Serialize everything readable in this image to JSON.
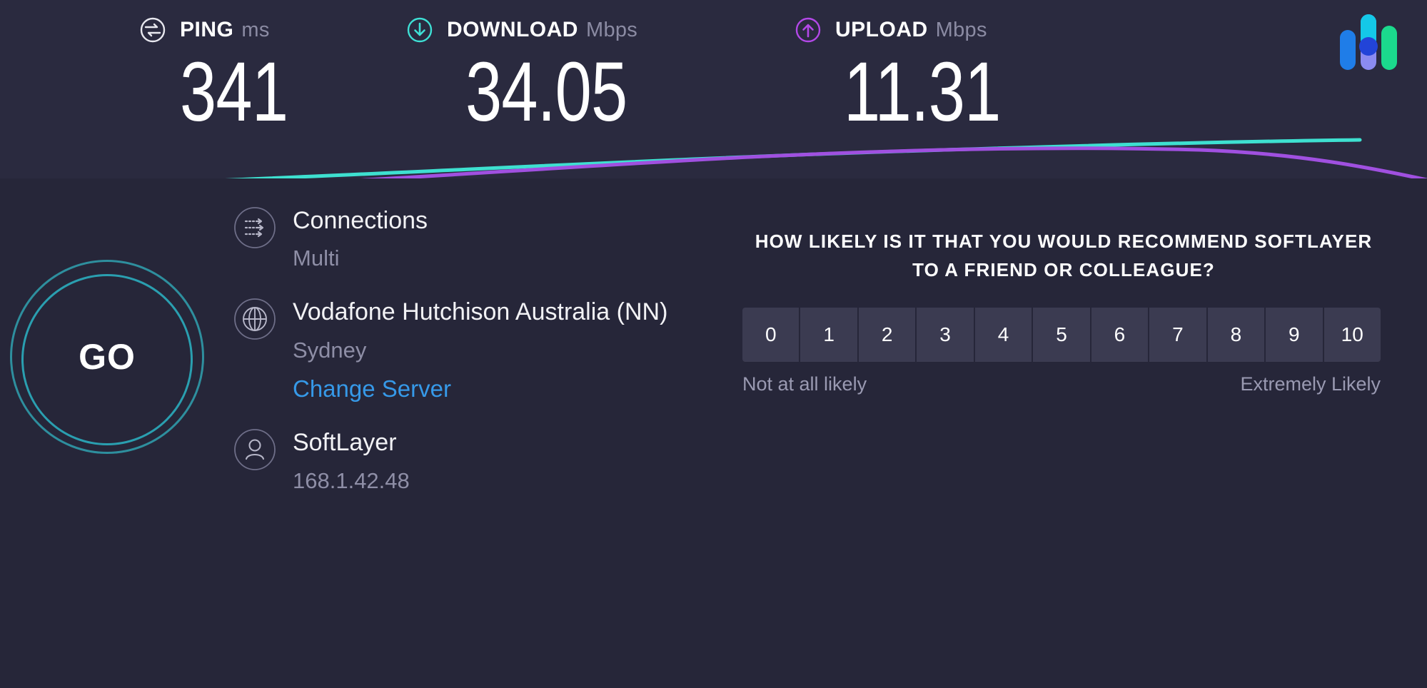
{
  "brand": {
    "logo_name": "speedtest-logo",
    "logo_colors": [
      "#1f7de8",
      "#14c8e8",
      "#8b8bf0",
      "#1bd98d"
    ]
  },
  "results": {
    "ping": {
      "label": "PING",
      "unit": "ms",
      "value": "341",
      "icon": "ping-icon",
      "icon_color": "#e8e8ef"
    },
    "download": {
      "label": "DOWNLOAD",
      "unit": "Mbps",
      "value": "34.05",
      "icon": "download-arrow-icon",
      "icon_color": "#3ee0d5"
    },
    "upload": {
      "label": "UPLOAD",
      "unit": "Mbps",
      "value": "11.31",
      "icon": "upload-arrow-icon",
      "icon_color": "#b348e8"
    }
  },
  "graph": {
    "download_line_color": "#3ee0d0",
    "upload_line_color": "#a050e0"
  },
  "go_button": {
    "label": "GO",
    "ring_color": "#2a9fb0"
  },
  "connection": {
    "connections": {
      "icon": "connections-icon",
      "title": "Connections",
      "value": "Multi"
    },
    "isp": {
      "icon": "globe-icon",
      "title": "Vodafone Hutchison Australia (NN)",
      "value": "Sydney",
      "link": "Change Server",
      "link_color": "#3699e8"
    },
    "host": {
      "icon": "person-icon",
      "title": "SoftLayer",
      "value": "168.1.42.48"
    }
  },
  "survey": {
    "question": "How likely is it that you would recommend SoftLayer to a friend or colleague?",
    "ratings": [
      "0",
      "1",
      "2",
      "3",
      "4",
      "5",
      "6",
      "7",
      "8",
      "9",
      "10"
    ],
    "low_label": "Not at all likely",
    "high_label": "Extremely Likely"
  }
}
